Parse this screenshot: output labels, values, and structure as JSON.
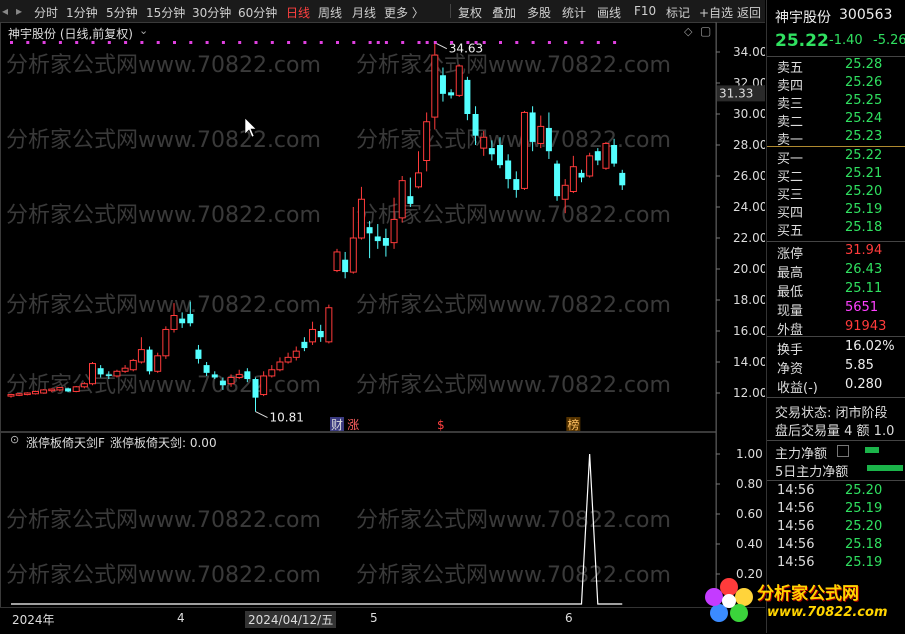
{
  "toolbar": {
    "items": [
      "分时",
      "1分钟",
      "5分钟",
      "15分钟",
      "30分钟",
      "60分钟",
      "日线",
      "周线",
      "月线",
      "更多 〉"
    ],
    "active_index": 6,
    "right_items": [
      "复权",
      "叠加",
      "多股",
      "统计",
      "画线",
      "F10",
      "标记",
      "+自选",
      "返回"
    ]
  },
  "chart": {
    "title": "神宇股份 (日线,前复权)",
    "price_ticks": [
      "34.00",
      "32.00",
      "30.00",
      "28.00",
      "26.00",
      "24.00",
      "22.00",
      "20.00",
      "18.00",
      "16.00",
      "14.00",
      "12.00"
    ],
    "current_price_label": "31.33",
    "high_marker": "34.63",
    "low_marker": "10.81",
    "event_labels": [
      "财",
      "涨",
      "$",
      "榜"
    ],
    "watermark": "分析家公式网www.70822.com"
  },
  "indicator": {
    "title": "涨停板倚天剑F",
    "value_label": "涨停板倚天剑: 0.00",
    "ticks": [
      "1.00",
      "0.80",
      "0.60",
      "0.40",
      "0.20"
    ]
  },
  "xaxis": {
    "labels": [
      "2024年",
      "4",
      "2024/04/12/五",
      "5",
      "6"
    ]
  },
  "panel": {
    "name": "神宇股份",
    "code": "300563",
    "price": "25.22",
    "change": "-1.40",
    "pct": "-5.26",
    "asks": [
      {
        "label": "卖五",
        "price": "25.28"
      },
      {
        "label": "卖四",
        "price": "25.26"
      },
      {
        "label": "卖三",
        "price": "25.25"
      },
      {
        "label": "卖二",
        "price": "25.24"
      },
      {
        "label": "卖一",
        "price": "25.23"
      }
    ],
    "bids": [
      {
        "label": "买一",
        "price": "25.22"
      },
      {
        "label": "买二",
        "price": "25.21"
      },
      {
        "label": "买三",
        "price": "25.20"
      },
      {
        "label": "买四",
        "price": "25.19"
      },
      {
        "label": "买五",
        "price": "25.18"
      }
    ],
    "stats": [
      {
        "label": "涨停",
        "value": "31.94",
        "color": "red"
      },
      {
        "label": "最高",
        "value": "26.43",
        "color": "grn"
      },
      {
        "label": "最低",
        "value": "25.11",
        "color": "grn"
      },
      {
        "label": "现量",
        "value": "5651",
        "color": "mag"
      },
      {
        "label": "外盘",
        "value": "91943",
        "color": "red"
      }
    ],
    "stats2": [
      {
        "label": "换手",
        "value": "16.02%"
      },
      {
        "label": "净资",
        "value": "5.85"
      },
      {
        "label": "收益(-)",
        "value": "0.280"
      }
    ],
    "trade_status": "交易状态: 闭市阶段",
    "after_hours": "盘后交易量 4 额 1.0",
    "main_flow": "主力净额",
    "main_flow5": "5日主力净额",
    "ticks": [
      {
        "time": "14:56",
        "price": "25.20"
      },
      {
        "time": "14:56",
        "price": "25.19"
      },
      {
        "time": "14:56",
        "price": "25.20"
      },
      {
        "time": "14:56",
        "price": "25.18"
      },
      {
        "time": "14:56",
        "price": "25.19"
      }
    ],
    "logo_text": "分析家公式网",
    "logo_url": "www.70822.com"
  },
  "candles": [
    [
      11.8,
      11.9,
      11.7,
      11.95,
      0
    ],
    [
      11.85,
      11.95,
      11.8,
      12.0,
      0
    ],
    [
      11.9,
      12.0,
      11.85,
      12.05,
      0
    ],
    [
      11.95,
      12.1,
      11.9,
      12.15,
      0
    ],
    [
      12.0,
      12.2,
      11.95,
      12.25,
      0
    ],
    [
      12.15,
      12.25,
      12.05,
      12.3,
      0
    ],
    [
      12.2,
      12.35,
      12.1,
      12.4,
      0
    ],
    [
      12.3,
      12.1,
      12.05,
      12.35,
      1
    ],
    [
      12.1,
      12.4,
      12.05,
      12.45,
      0
    ],
    [
      12.4,
      12.6,
      12.3,
      12.7,
      0
    ],
    [
      12.6,
      13.9,
      12.5,
      14.0,
      0
    ],
    [
      13.6,
      13.2,
      13.0,
      13.8,
      1
    ],
    [
      13.2,
      13.1,
      12.9,
      13.4,
      1
    ],
    [
      13.1,
      13.4,
      13.0,
      13.5,
      0
    ],
    [
      13.4,
      13.6,
      13.3,
      13.8,
      0
    ],
    [
      13.5,
      14.1,
      13.4,
      14.2,
      0
    ],
    [
      14.0,
      14.8,
      13.9,
      15.6,
      0
    ],
    [
      14.8,
      13.4,
      13.2,
      15.0,
      1
    ],
    [
      13.4,
      14.4,
      13.3,
      14.6,
      0
    ],
    [
      14.4,
      16.1,
      14.2,
      16.3,
      0
    ],
    [
      16.1,
      17.0,
      15.9,
      17.8,
      0
    ],
    [
      16.8,
      16.5,
      16.2,
      17.2,
      1
    ],
    [
      16.5,
      17.1,
      16.3,
      17.9,
      1
    ],
    [
      14.8,
      14.2,
      13.9,
      15.1,
      1
    ],
    [
      13.8,
      13.3,
      13.1,
      14.0,
      1
    ],
    [
      13.2,
      13.0,
      12.9,
      13.4,
      1
    ],
    [
      12.8,
      12.5,
      12.2,
      13.0,
      1
    ],
    [
      12.6,
      13.0,
      12.4,
      13.2,
      0
    ],
    [
      13.0,
      13.2,
      12.9,
      13.5,
      0
    ],
    [
      13.4,
      12.9,
      12.7,
      13.6,
      1
    ],
    [
      12.9,
      11.7,
      10.8,
      13.0,
      1
    ],
    [
      11.9,
      13.1,
      11.8,
      13.4,
      0
    ],
    [
      13.1,
      13.5,
      13.0,
      13.8,
      0
    ],
    [
      13.5,
      14.0,
      13.4,
      14.3,
      0
    ],
    [
      14.0,
      14.3,
      13.9,
      14.6,
      0
    ],
    [
      14.3,
      14.7,
      14.1,
      15.0,
      0
    ],
    [
      14.9,
      15.3,
      14.7,
      15.6,
      1
    ],
    [
      15.3,
      16.1,
      15.1,
      16.6,
      0
    ],
    [
      16.0,
      15.6,
      15.3,
      16.4,
      1
    ],
    [
      15.3,
      17.5,
      15.2,
      17.7,
      0
    ],
    [
      19.9,
      21.1,
      19.8,
      21.3,
      0
    ],
    [
      20.6,
      19.8,
      19.4,
      21.1,
      1
    ],
    [
      19.8,
      22.0,
      19.7,
      24.0,
      0
    ],
    [
      22.0,
      24.5,
      21.9,
      25.3,
      0
    ],
    [
      22.7,
      22.3,
      20.7,
      23.1,
      1
    ],
    [
      22.1,
      21.8,
      21.3,
      22.9,
      1
    ],
    [
      22.0,
      21.5,
      20.8,
      22.6,
      1
    ],
    [
      21.7,
      23.2,
      21.3,
      24.6,
      0
    ],
    [
      23.3,
      25.7,
      23.0,
      26.0,
      0
    ],
    [
      24.7,
      24.2,
      24.0,
      25.9,
      1
    ],
    [
      25.3,
      26.2,
      25.2,
      27.6,
      0
    ],
    [
      27.0,
      29.5,
      26.3,
      30.1,
      0
    ],
    [
      29.8,
      33.8,
      29.0,
      34.6,
      0
    ],
    [
      32.5,
      31.3,
      30.8,
      33.0,
      1
    ],
    [
      31.2,
      31.4,
      31.0,
      31.6,
      1
    ],
    [
      31.2,
      33.1,
      31.1,
      33.2,
      0
    ],
    [
      32.2,
      30.0,
      29.6,
      32.4,
      1
    ],
    [
      30.0,
      28.6,
      28.0,
      30.5,
      1
    ],
    [
      28.5,
      27.8,
      27.3,
      28.9,
      0
    ],
    [
      27.8,
      27.4,
      27.0,
      28.3,
      1
    ],
    [
      28.0,
      26.7,
      26.5,
      28.5,
      1
    ],
    [
      27.0,
      25.8,
      25.2,
      27.4,
      1
    ],
    [
      25.8,
      25.1,
      24.6,
      26.3,
      1
    ],
    [
      25.2,
      30.1,
      25.1,
      30.2,
      0
    ],
    [
      30.1,
      28.2,
      27.6,
      30.5,
      1
    ],
    [
      28.1,
      29.2,
      27.8,
      29.9,
      0
    ],
    [
      29.1,
      27.6,
      27.1,
      30.1,
      1
    ],
    [
      26.8,
      24.7,
      24.4,
      27.0,
      1
    ],
    [
      24.5,
      25.4,
      23.6,
      25.8,
      0
    ],
    [
      25.0,
      26.6,
      24.9,
      27.3,
      0
    ],
    [
      26.2,
      25.9,
      25.6,
      26.4,
      1
    ],
    [
      26.0,
      27.3,
      25.9,
      27.5,
      0
    ],
    [
      27.6,
      27.0,
      26.7,
      27.8,
      1
    ],
    [
      26.5,
      28.1,
      26.4,
      28.2,
      0
    ],
    [
      28.0,
      26.8,
      26.6,
      28.4,
      1
    ],
    [
      26.2,
      25.4,
      25.1,
      26.4,
      1
    ]
  ]
}
